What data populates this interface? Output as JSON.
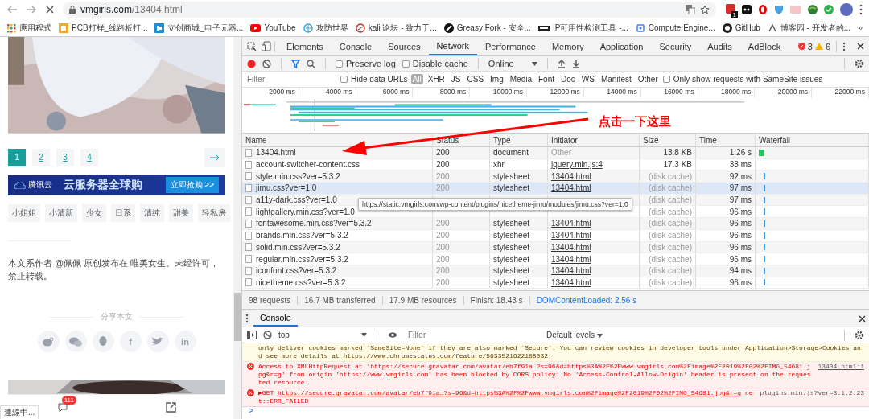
{
  "browser": {
    "url_host": "vmgirls.com",
    "url_path": "/13404.html",
    "extension_badge": "1",
    "bookmarks": [
      {
        "label": "應用程式",
        "kind": "apps"
      },
      {
        "label": "PCB打样_线路板打...",
        "kind": "pcb"
      },
      {
        "label": "立创商城_电子元器...",
        "kind": "lc"
      },
      {
        "label": "YouTube",
        "kind": "youtube"
      },
      {
        "label": "攻防世界",
        "kind": "globe"
      },
      {
        "label": "kali 论坛 - 致力于...",
        "kind": "kali"
      },
      {
        "label": "Greasy Fork - 安全...",
        "kind": "monkey"
      },
      {
        "label": "IP可用性检测工具 -...",
        "kind": "tool"
      },
      {
        "label": "Compute Engine...",
        "kind": "chip"
      },
      {
        "label": "GitHub",
        "kind": "github"
      },
      {
        "label": "博客园 - 开发者的...",
        "kind": "blog"
      }
    ],
    "more": "»"
  },
  "page": {
    "pagination": [
      {
        "label": "1",
        "selected": true
      },
      {
        "label": "2",
        "selected": false
      },
      {
        "label": "3",
        "selected": false
      },
      {
        "label": "4",
        "selected": false
      }
    ],
    "ad": {
      "brand": "腾讯云",
      "headline": "云服务器全球购",
      "cta": "立即抢购 >>"
    },
    "tags": [
      "小姐姐",
      "小清新",
      "少女",
      "日系",
      "清纯",
      "甜美",
      "轻私房"
    ],
    "notice": "本文系作者 @佩佩 原创发布在 唯美女生。未经许可，禁止转载。",
    "share_title": "分享本文",
    "share_buttons": [
      {
        "kind": "weibo"
      },
      {
        "kind": "wechat"
      },
      {
        "kind": "qq"
      },
      {
        "kind": "glyph",
        "glyph": "f"
      },
      {
        "kind": "twitter"
      },
      {
        "kind": "glyph",
        "glyph": "in"
      }
    ],
    "comment_badge": "111",
    "status_text": "連線中..."
  },
  "devtools": {
    "tabs": [
      {
        "label": "Elements",
        "selected": false
      },
      {
        "label": "Console",
        "selected": false
      },
      {
        "label": "Sources",
        "selected": false
      },
      {
        "label": "Network",
        "selected": true
      },
      {
        "label": "Performance",
        "selected": false
      },
      {
        "label": "Memory",
        "selected": false
      },
      {
        "label": "Application",
        "selected": false
      },
      {
        "label": "Security",
        "selected": false
      },
      {
        "label": "Audits",
        "selected": false
      },
      {
        "label": "AdBlock",
        "selected": false
      }
    ],
    "errors": "3",
    "warnings": "6",
    "preserve_log": {
      "label": "Preserve log",
      "checked": false
    },
    "disable_cache": {
      "label": "Disable cache",
      "checked": false
    },
    "throttling": "Online",
    "filter": {
      "placeholder": "Filter",
      "hide_data_urls": {
        "label": "Hide data URLs",
        "checked": false
      },
      "types": [
        {
          "label": "All",
          "selected": true
        },
        {
          "label": "XHR",
          "selected": false
        },
        {
          "label": "JS",
          "selected": false
        },
        {
          "label": "CSS",
          "selected": false
        },
        {
          "label": "Img",
          "selected": false
        },
        {
          "label": "Media",
          "selected": false
        },
        {
          "label": "Font",
          "selected": false
        },
        {
          "label": "Doc",
          "selected": false
        },
        {
          "label": "WS",
          "selected": false
        },
        {
          "label": "Manifest",
          "selected": false
        },
        {
          "label": "Other",
          "selected": false
        }
      ],
      "samesite": {
        "label": "Only show requests with SameSite issues",
        "checked": false
      }
    },
    "overview_ticks": [
      "2000 ms",
      "4000 ms",
      "6000 ms",
      "8000 ms",
      "10000 ms",
      "12000 ms",
      "14000 ms",
      "16000 ms",
      "18000 ms",
      "20000 ms",
      "22000 ms"
    ],
    "annotation": "点击一下这里",
    "columns": [
      "Name",
      "Status",
      "Type",
      "Initiator",
      "Size",
      "Time",
      "Waterfall"
    ],
    "rows": [
      {
        "name": "13404.html",
        "status": "200",
        "from_cache": false,
        "type": "document",
        "initiator": "Other",
        "initiator_link": false,
        "size": "13.8 KB",
        "time": "1.26 s",
        "hovered": false,
        "color": "#22c55e"
      },
      {
        "name": "account-switcher-content.css",
        "status": "200",
        "from_cache": false,
        "type": "xhr",
        "initiator": "jquery.min.js:4",
        "initiator_link": true,
        "size": "17.3 KB",
        "time": "33 ms",
        "hovered": false
      },
      {
        "name": "style.min.css?ver=5.3.2",
        "status": "200",
        "from_cache": true,
        "type": "stylesheet",
        "initiator": "13404.html",
        "initiator_link": true,
        "size": "(disk cache)",
        "time": "92 ms",
        "hovered": false,
        "color": "#3b9be8"
      },
      {
        "name": "jimu.css?ver=1.0",
        "status": "200",
        "from_cache": true,
        "type": "stylesheet",
        "initiator": "13404.html",
        "initiator_link": true,
        "size": "(disk cache)",
        "time": "97 ms",
        "hovered": true,
        "color": "#3b9be8"
      },
      {
        "name": "a11y-dark.css?ver=1.0",
        "size": "(disk cache)",
        "time": "97 ms",
        "hovered": false,
        "from_cache": true,
        "color": "#3b9be8"
      },
      {
        "name": "lightgallery.min.css?ver=1.0",
        "size": "(disk cache)",
        "time": "96 ms",
        "hovered": false,
        "from_cache": true,
        "color": "#3b9be8"
      },
      {
        "name": "fontawesome.min.css?ver=5.3.2",
        "status": "200",
        "from_cache": true,
        "type": "stylesheet",
        "initiator": "13404.html",
        "initiator_link": true,
        "size": "(disk cache)",
        "time": "96 ms",
        "hovered": false,
        "color": "#3b9be8"
      },
      {
        "name": "brands.min.css?ver=5.3.2",
        "status": "200",
        "from_cache": true,
        "type": "stylesheet",
        "initiator": "13404.html",
        "initiator_link": true,
        "size": "(disk cache)",
        "time": "96 ms",
        "hovered": false,
        "color": "#3b9be8"
      },
      {
        "name": "solid.min.css?ver=5.3.2",
        "status": "200",
        "from_cache": true,
        "type": "stylesheet",
        "initiator": "13404.html",
        "initiator_link": true,
        "size": "(disk cache)",
        "time": "96 ms",
        "hovered": false,
        "color": "#3b9be8"
      },
      {
        "name": "regular.min.css?ver=5.3.2",
        "status": "200",
        "from_cache": true,
        "type": "stylesheet",
        "initiator": "13404.html",
        "initiator_link": true,
        "size": "(disk cache)",
        "time": "96 ms",
        "hovered": false,
        "color": "#3b9be8"
      },
      {
        "name": "iconfont.css?ver=5.3.2",
        "status": "200",
        "from_cache": true,
        "type": "stylesheet",
        "initiator": "13404.html",
        "initiator_link": true,
        "size": "(disk cache)",
        "time": "94 ms",
        "hovered": false,
        "color": "#3b9be8"
      },
      {
        "name": "nicetheme.css?ver=5.3.2",
        "status": "200",
        "from_cache": true,
        "type": "stylesheet",
        "initiator": "13404.html",
        "initiator_link": true,
        "size": "(disk cache)",
        "time": "96 ms",
        "hovered": false,
        "color": "#3b9be8"
      }
    ],
    "tooltip": "https://static.vmgirls.com/wp-content/plugins/nicetheme-jimu/modules/jimu.css?ver=1.0",
    "summary": [
      {
        "text": "98 requests",
        "kind": "plain"
      },
      {
        "text": "16.7 MB transferred",
        "kind": "plain"
      },
      {
        "text": "17.9 MB resources",
        "kind": "plain"
      },
      {
        "text": "Finish: 18.43 s",
        "kind": "plain"
      },
      {
        "text": "DOMContentLoaded: 2.56 s",
        "kind": "dom"
      }
    ],
    "console": {
      "tab": "Console",
      "context": "top",
      "filter_placeholder": "Filter",
      "levels": "Default levels",
      "messages": [
        {
          "kind": "warning",
          "before": "only deliver cookies marked `SameSite=None` if they are also marked `Secure`. You can review cookies in developer tools under Application>Storage>Cookies and see more details at ",
          "link": "https://www.chromestatus.com/feature/5633521622188032",
          "after": "."
        },
        {
          "kind": "error",
          "before": "Access to XMLHttpRequest at 'https://secure.gravatar.com/avatar/eb7f91a…?s=96&d=https%3A%2F%2Fwww.vmgirls.com%2Fimage%2F2019%2F02%2FIMG_54681.jpg&r=g' from origin 'https://www.vmgirls.com' has been blocked by CORS policy: No 'Access-Control-Allow-Origin' header is present on the requested resource.",
          "source": "13404.html:1"
        },
        {
          "kind": "error",
          "expander": "▶",
          "before": "GET ",
          "link": "https://secure.gravatar.com/avatar/eb7f91a…?s=96&d=https%3A%2F%2Fwww.vmgirls.com%2Fimage%2F2019%2F02%2FIMG_54681.jpg&r=g",
          "after": " net::ERR_FAILED",
          "source": "plugins.min.js?ver=3.1.2:23"
        }
      ],
      "prompt": ">"
    }
  }
}
